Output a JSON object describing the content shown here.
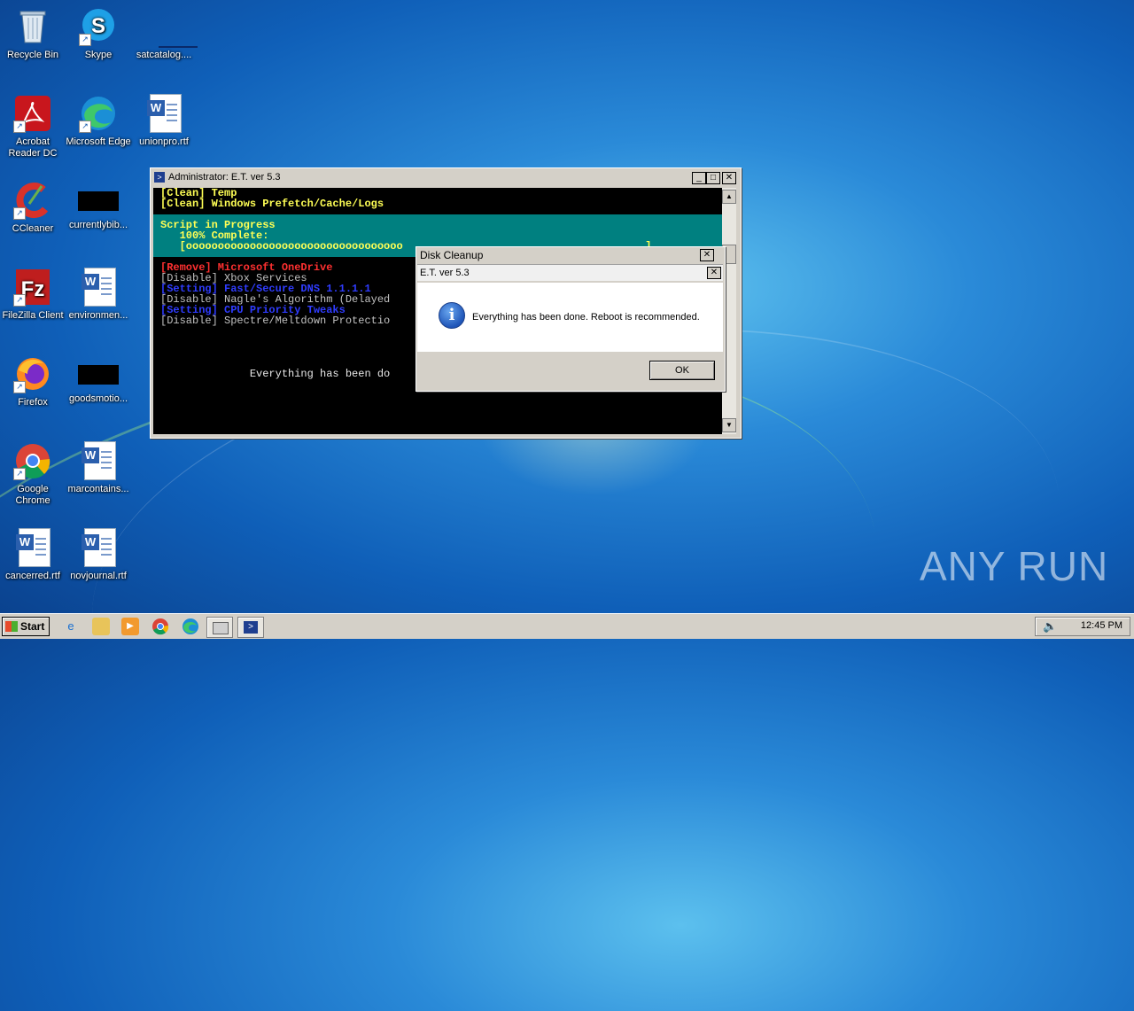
{
  "desktop": {
    "icons": [
      {
        "label": "Recycle Bin"
      },
      {
        "label": "Skype"
      },
      {
        "label": "satcatalog...."
      },
      {
        "label": "Acrobat Reader DC"
      },
      {
        "label": "Microsoft Edge"
      },
      {
        "label": "unionpro.rtf"
      },
      {
        "label": "CCleaner"
      },
      {
        "label": "currentlybib..."
      },
      {
        "label": "FileZilla Client"
      },
      {
        "label": "environmen..."
      },
      {
        "label": "Firefox"
      },
      {
        "label": "goodsmotio..."
      },
      {
        "label": "Google Chrome"
      },
      {
        "label": "marcontains..."
      },
      {
        "label": "cancerred.rtf"
      },
      {
        "label": "novjournal.rtf"
      }
    ]
  },
  "console": {
    "title": "Administrator: E.T. ver 5.3",
    "lines": {
      "l1": "[Clean] Temp",
      "l2": "[Clean] Windows Prefetch/Cache/Logs",
      "progress_title": "Script in Progress",
      "progress_pct": "   100% Complete:",
      "progress_bar": "   [oooooooooooooooooooooooooooooooooo                                      ]",
      "l3": "[Remove] Microsoft OneDrive",
      "l4": "[Disable] Xbox Services",
      "l5": "[Setting] Fast/Secure DNS 1.1.1.1",
      "l6": "[Disable] Nagle's Algorithm (Delayed",
      "l7": "[Setting] CPU Priority Tweaks",
      "l8": "[Disable] Spectre/Meltdown Protectio",
      "done": "              Everything has been do"
    }
  },
  "dialog": {
    "outer_title": "Disk Cleanup",
    "inner_title": "E.T. ver 5.3",
    "message": "Everything has been done. Reboot is recommended.",
    "ok_label": "OK"
  },
  "taskbar": {
    "start_label": "Start",
    "clock": "12:45 PM"
  },
  "watermark": "ANY RUN"
}
